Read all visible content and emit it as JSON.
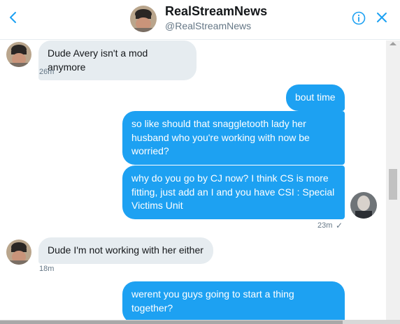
{
  "header": {
    "title": "RealStreamNews",
    "handle": "@RealStreamNews"
  },
  "messages": [
    {
      "direction": "incoming",
      "text": "Dude Avery isn't a mod anymore",
      "time": "26m"
    },
    {
      "direction": "outgoing",
      "text": "bout time"
    },
    {
      "direction": "outgoing",
      "line1": "so like should that snaggletooth lady her",
      "line2": "husband who you're working with now be",
      "line3": "worried?"
    },
    {
      "direction": "outgoing",
      "line1": "why do you go by CJ now? I think CS is more",
      "line2": "fitting, just add an I and you have CSI : Special",
      "line3": "Victims Unit",
      "time": "23m",
      "status": "✓"
    },
    {
      "direction": "incoming",
      "text": "Dude I'm not working with her either",
      "time": "18m"
    },
    {
      "direction": "outgoing",
      "line1": "werent you guys going to start a thing",
      "line2": "together?"
    }
  ],
  "icons": {
    "back": "chevron-left-icon",
    "info": "info-icon",
    "close": "close-icon"
  },
  "colors": {
    "outgoing_bubble": "#1da1f2",
    "incoming_bubble": "#e6ecf0",
    "meta_text": "#657786"
  }
}
